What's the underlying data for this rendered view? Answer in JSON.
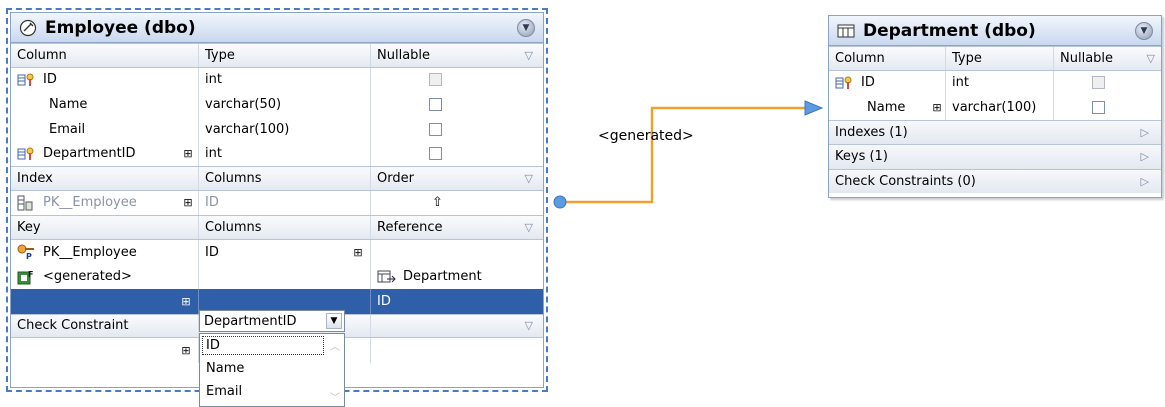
{
  "employee": {
    "title": "Employee (dbo)",
    "columns_header": {
      "col": "Column",
      "type": "Type",
      "nullable": "Nullable"
    },
    "columns": [
      {
        "name": "ID",
        "type": "int",
        "pk": true
      },
      {
        "name": "Name",
        "type": "varchar(50)"
      },
      {
        "name": "Email",
        "type": "varchar(100)"
      },
      {
        "name": "DepartmentID",
        "type": "int",
        "fk": true
      }
    ],
    "index_header": {
      "col": "Index",
      "columns": "Columns",
      "order": "Order"
    },
    "index_row": {
      "name": "PK__Employee",
      "columns": "ID",
      "order_icon": "arrow-up-icon"
    },
    "key_header": {
      "col": "Key",
      "columns": "Columns",
      "reference": "Reference"
    },
    "keys": [
      {
        "name": "PK__Employee",
        "columns": "ID",
        "reference": ""
      },
      {
        "name": "<generated>",
        "columns": "",
        "reference": "Department"
      }
    ],
    "selected_row": {
      "column_value": "DepartmentID",
      "reference_value": "ID"
    },
    "check_header": {
      "col": "Check Constraint"
    }
  },
  "dropdown": {
    "selected": "DepartmentID",
    "options": [
      "ID",
      "Name",
      "Email"
    ]
  },
  "relationship": {
    "label": "<generated>"
  },
  "department": {
    "title": "Department (dbo)",
    "columns_header": {
      "col": "Column",
      "type": "Type",
      "nullable": "Nullable"
    },
    "columns": [
      {
        "name": "ID",
        "type": "int"
      },
      {
        "name": "Name",
        "type": "varchar(100)"
      }
    ],
    "sections": [
      "Indexes (1)",
      "Keys (1)",
      "Check Constraints (0)"
    ]
  },
  "colors": {
    "accent": "#4a79c8",
    "selection": "#2f5fa8",
    "relation_line": "#f0a030",
    "relation_arrow": "#5b9be0"
  }
}
